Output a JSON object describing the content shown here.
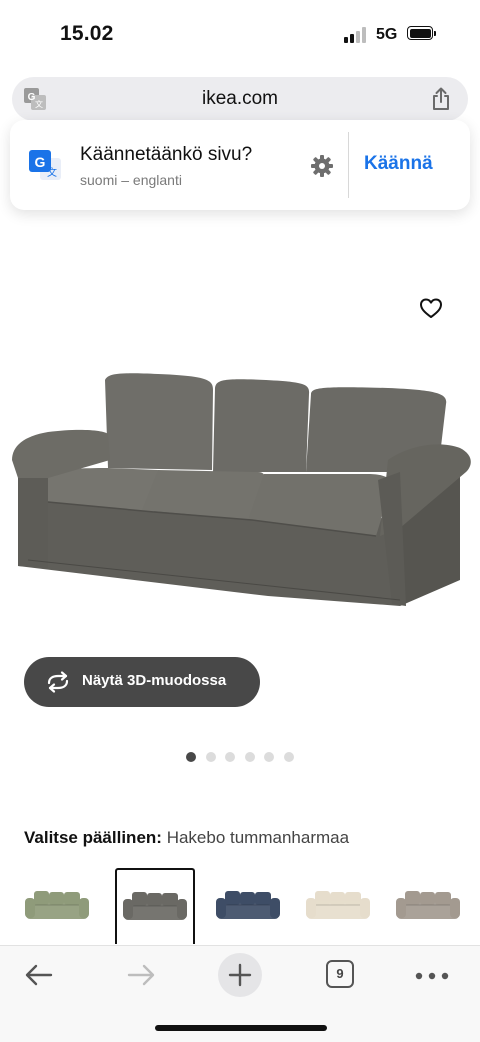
{
  "status_bar": {
    "time": "15.02",
    "network": "5G"
  },
  "address_bar": {
    "url": "ikea.com",
    "left_icon": "translate-icon",
    "right_icon": "share-icon"
  },
  "translate_banner": {
    "title": "Käännetäänkö sivu?",
    "subtitle": "suomi – englanti",
    "action": "Käännä",
    "accent": "#1a73e8"
  },
  "product": {
    "view_3d_label": "Näytä 3D-muodossa",
    "image_count": 6,
    "active_image": 1,
    "cover_label": "Valitse päällinen:",
    "cover_value": "Hakebo tummanharmaa",
    "swatches": [
      {
        "color": "#8f9b7a",
        "selected": false
      },
      {
        "color": "#6a6964",
        "selected": true
      },
      {
        "color": "#3e4d66",
        "selected": false
      },
      {
        "color": "#e6ddcc",
        "selected": false
      },
      {
        "color": "#a39a90",
        "selected": false
      }
    ]
  },
  "toolbar": {
    "tab_count": "9"
  }
}
